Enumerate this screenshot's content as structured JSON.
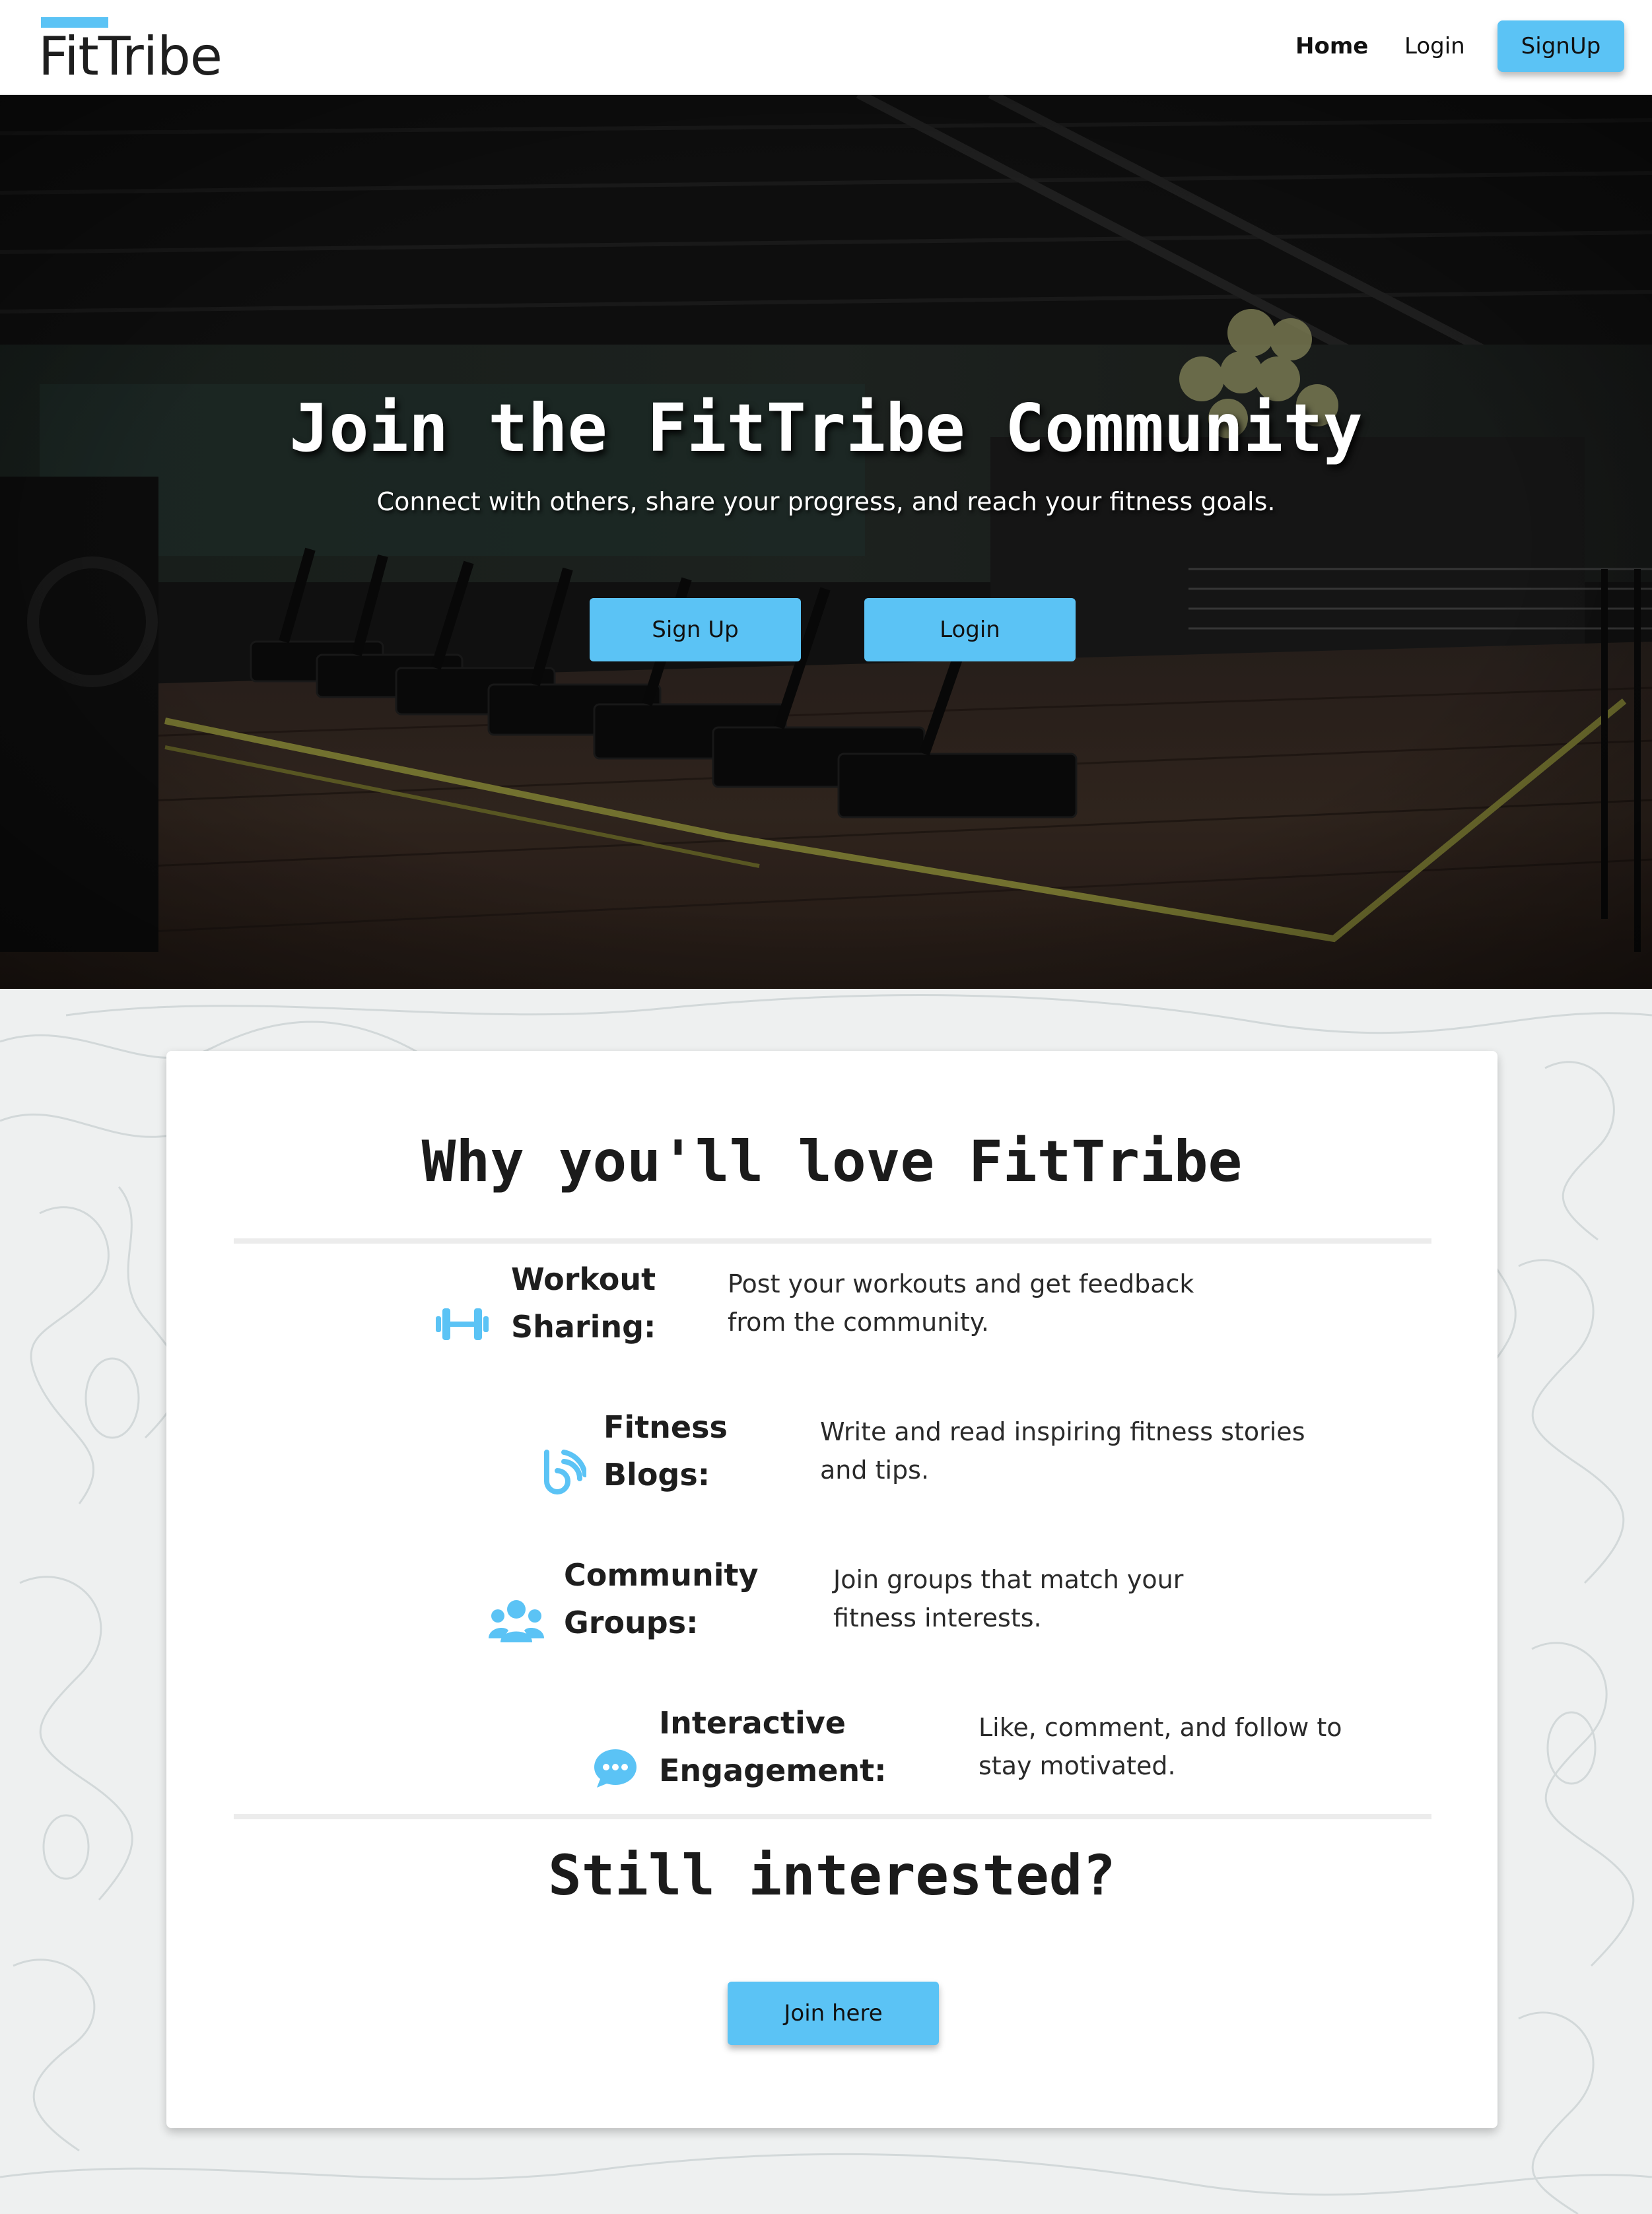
{
  "brand": {
    "name": "FitTribe",
    "accent_color": "#5bc3f5"
  },
  "nav": {
    "home": "Home",
    "login": "Login",
    "signup": "SignUp"
  },
  "hero": {
    "title": "Join the FitTribe Community",
    "subtitle": "Connect with others, share your progress, and reach your fitness goals.",
    "signup_button": "Sign Up",
    "login_button": "Login",
    "background_image": "dark gym interior with rows of treadmills"
  },
  "why": {
    "title": "Why you'll love FitTribe",
    "features": [
      {
        "icon": "dumbbell-icon",
        "title_lines": [
          "Workout",
          "Sharing:"
        ],
        "desc_lines": [
          "Post your workouts and get feedback",
          "from the community."
        ]
      },
      {
        "icon": "blog-icon",
        "title_lines": [
          "Fitness",
          "Blogs:"
        ],
        "desc_lines": [
          "Write and read inspiring fitness stories",
          "and tips."
        ]
      },
      {
        "icon": "users-icon",
        "title_lines": [
          "Community",
          "Groups:"
        ],
        "desc_lines": [
          "Join groups that match your",
          "fitness interests."
        ]
      },
      {
        "icon": "chat-icon",
        "title_lines": [
          "Interactive",
          "Engagement:"
        ],
        "desc_lines": [
          "Like, comment, and follow to",
          "stay motivated."
        ]
      }
    ]
  },
  "cta": {
    "title": "Still interested?",
    "button": "Join here"
  }
}
